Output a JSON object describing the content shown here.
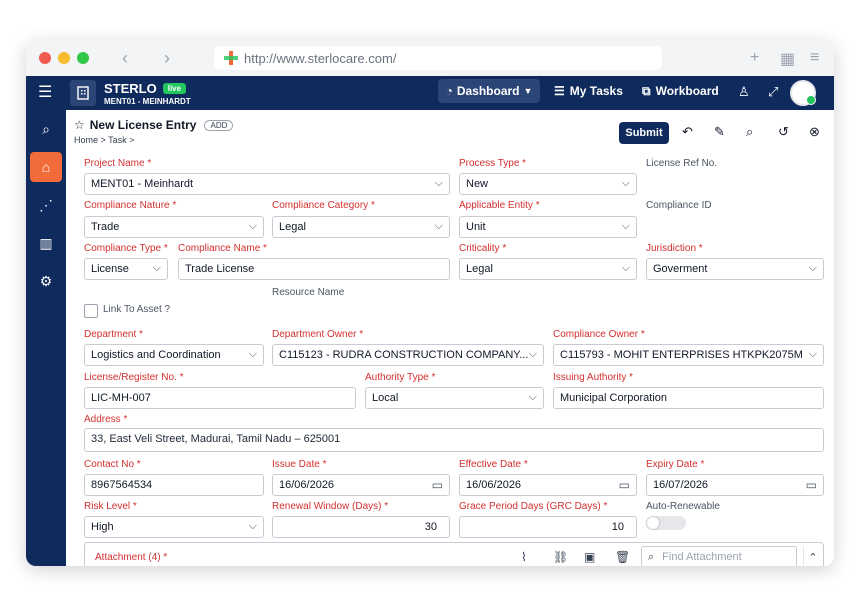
{
  "browser": {
    "url": "http://www.sterlocare.com/"
  },
  "topbar": {
    "brand": "STERLO",
    "live": "live",
    "project": "MENT01 - MEINHARDT",
    "dashboard": "Dashboard",
    "my_tasks": "My Tasks",
    "workboard": "Workboard"
  },
  "page": {
    "title": "New License Entry",
    "add": "ADD",
    "breadcrumb": "Home  >  Task  >",
    "submit": "Submit"
  },
  "form": {
    "project_name": {
      "label": "Project Name",
      "value": "MENT01 - Meinhardt"
    },
    "process_type": {
      "label": "Process Type",
      "value": "New"
    },
    "license_ref": {
      "label": "License Ref No."
    },
    "compliance_nature": {
      "label": "Compliance Nature",
      "value": "Trade"
    },
    "compliance_category": {
      "label": "Compliance Category",
      "value": "Legal"
    },
    "applicable_entity": {
      "label": "Applicable Entity",
      "value": "Unit"
    },
    "compliance_id": {
      "label": "Compliance ID"
    },
    "compliance_type": {
      "label": "Compliance Type",
      "value": "License"
    },
    "compliance_name": {
      "label": "Compliance Name",
      "value": "Trade License"
    },
    "criticality": {
      "label": "Criticality",
      "value": "Legal"
    },
    "jurisdiction": {
      "label": "Jurisdiction",
      "value": "Goverment"
    },
    "resource_name": {
      "label": "Resource Name"
    },
    "link_asset": {
      "label": "Link To Asset ?"
    },
    "department": {
      "label": "Department",
      "value": "Logistics and Coordination"
    },
    "department_owner": {
      "label": "Department Owner",
      "value": "C115123 - RUDRA CONSTRUCTION COMPANY..."
    },
    "compliance_owner": {
      "label": "Compliance Owner",
      "value": "C115793 - MOHIT ENTERPRISES  HTKPK2075M"
    },
    "license_no": {
      "label": "License/Register No.",
      "value": "LIC-MH-007"
    },
    "authority_type": {
      "label": "Authority Type",
      "value": "Local"
    },
    "issuing_authority": {
      "label": "Issuing Authority",
      "value": "Municipal Corporation"
    },
    "address": {
      "label": "Address",
      "value": "33, East Veli Street, Madurai, Tamil Nadu – 625001"
    },
    "contact_no": {
      "label": "Contact No",
      "value": "8967564534"
    },
    "issue_date": {
      "label": "Issue Date",
      "value": "16/06/2026"
    },
    "effective_date": {
      "label": "Effective Date",
      "value": "16/06/2026"
    },
    "expiry_date": {
      "label": "Expiry Date",
      "value": "16/07/2026"
    },
    "risk_level": {
      "label": "Risk Level",
      "value": "High"
    },
    "renewal_window": {
      "label": "Renewal Window (Days)",
      "value": "30"
    },
    "grace_period": {
      "label": "Grace Period Days (GRC Days)",
      "value": "10"
    },
    "auto_renewable": {
      "label": "Auto-Renewable",
      "on": false
    },
    "attachment": {
      "label": "Attachment (4)",
      "find_placeholder": "Find Attachment"
    }
  },
  "colors": {
    "navy": "#0f2a5c",
    "accent": "#f26b3a",
    "required": "#d32f2f"
  }
}
